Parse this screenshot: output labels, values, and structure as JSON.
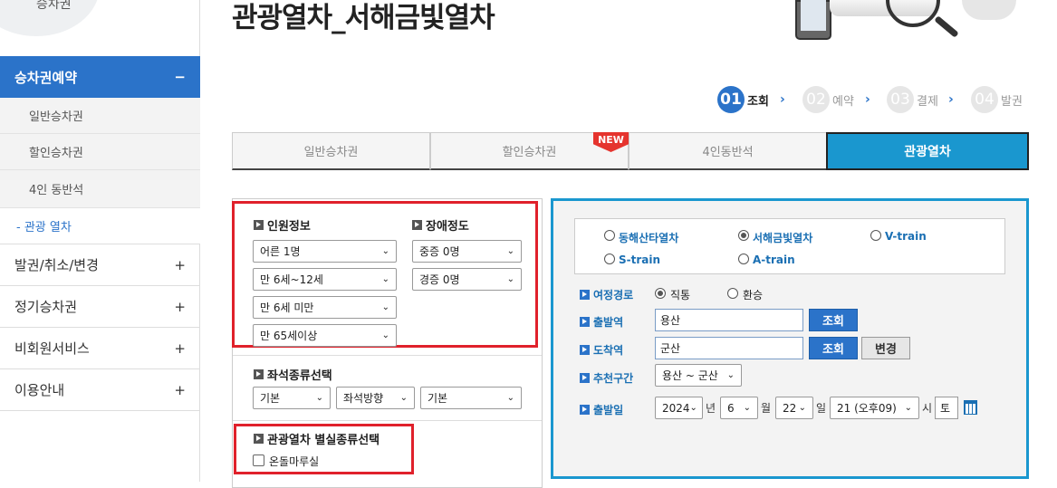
{
  "sidebar": {
    "logo_text": "승차권",
    "sections": [
      {
        "label": "승차권예약",
        "toggle": "−",
        "active": true
      },
      {
        "label": "발권/취소/변경",
        "toggle": "+"
      },
      {
        "label": "정기승차권",
        "toggle": "+"
      },
      {
        "label": "비회원서비스",
        "toggle": "+"
      },
      {
        "label": "이용안내",
        "toggle": "+"
      }
    ],
    "sub_items": [
      {
        "label": "일반승차권"
      },
      {
        "label": "할인승차권"
      },
      {
        "label": "4인 동반석"
      },
      {
        "label": "- 관광 열차",
        "current": true
      }
    ]
  },
  "header": {
    "title": "관광열차_서해금빛열차"
  },
  "steps": [
    {
      "num": "01",
      "label": "조회",
      "active": true
    },
    {
      "num": "02",
      "label": "예약"
    },
    {
      "num": "03",
      "label": "결제"
    },
    {
      "num": "04",
      "label": "발권"
    }
  ],
  "step_arrow": "›",
  "tabs": [
    {
      "label": "일반승차권"
    },
    {
      "label": "할인승차권",
      "badge": "NEW"
    },
    {
      "label": "4인동반석"
    },
    {
      "label": "관광열차",
      "active": true
    }
  ],
  "passenger": {
    "title": "인원정보",
    "selects": [
      "어른 1명",
      "만 6세~12세",
      "만 6세 미만",
      "만 65세이상"
    ]
  },
  "disability": {
    "title": "장애정도",
    "selects": [
      "중증 0명",
      "경증 0명"
    ]
  },
  "seat": {
    "title": "좌석종류선택",
    "selects": [
      "기본",
      "좌석방향",
      "기본"
    ]
  },
  "special": {
    "title": "관광열차 별실종류선택",
    "checkbox_label": "온돌마루실",
    "checked": false
  },
  "trains": [
    {
      "label": "동해산타열차",
      "selected": false
    },
    {
      "label": "서해금빛열차",
      "selected": true
    },
    {
      "label": "V-train",
      "selected": false
    },
    {
      "label": "S-train",
      "selected": false
    },
    {
      "label": "A-train",
      "selected": false
    }
  ],
  "route": {
    "label": "여정경로",
    "options": [
      {
        "label": "직통",
        "selected": true
      },
      {
        "label": "환승",
        "selected": false
      }
    ]
  },
  "departure": {
    "label": "출발역",
    "value": "용산",
    "button": "조회"
  },
  "arrival": {
    "label": "도착역",
    "value": "군산",
    "button": "조회",
    "change_button": "변경"
  },
  "recommend": {
    "label": "추천구간",
    "value": "용산 ~ 군산"
  },
  "date": {
    "label": "출발일",
    "year": "2024",
    "year_unit": "년",
    "month": "6",
    "month_unit": "월",
    "day": "22",
    "day_unit": "일",
    "hour": "21 (오후09)",
    "hour_unit": "시",
    "weekday": "토"
  },
  "chevron": "⌄",
  "colors": {
    "accent": "#2b73c9",
    "tab_active": "#1a97cf",
    "highlight_box": "#e0212b",
    "new_badge": "#e5342e"
  }
}
